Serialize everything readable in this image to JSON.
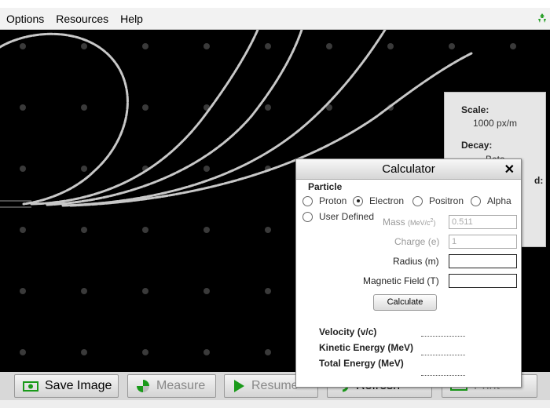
{
  "menu": [
    "Options",
    "Resources",
    "Help"
  ],
  "info_panel": {
    "scale_label": "Scale:",
    "scale_value": "1000 px/m",
    "decay_label": "Decay:",
    "decay_value": "Beta",
    "partial_label": "d:"
  },
  "toolbar": {
    "save_image": "Save Image",
    "measure": "Measure",
    "resume": "Resume",
    "refresh": "Refresh",
    "print": "Print"
  },
  "calculator": {
    "title": "Calculator",
    "close": "✕",
    "particle_heading": "Particle",
    "particles": [
      "Proton",
      "Electron",
      "Positron",
      "Alpha"
    ],
    "selected_particle": "Electron",
    "user_defined": "User Defined",
    "mass_label": "Mass",
    "mass_unit": "(MeV/c",
    "mass_unit_sup": "2",
    "mass_unit_end": ")",
    "mass_value": "0.511",
    "charge_label": "Charge (e)",
    "charge_value": "1",
    "radius_label": "Radius (m)",
    "radius_value": "",
    "field_label": "Magnetic Field (T)",
    "field_value": "",
    "calculate_button": "Calculate",
    "results": [
      "Velocity (v/c)",
      "Kinetic Energy (MeV)",
      "Total Energy (MeV)"
    ]
  },
  "colors": {
    "background": "#000000",
    "track": "#c8c8c8",
    "grid_dot": "#3a3a3a",
    "accent_green": "#1a9a1a"
  },
  "icons": [
    "recycle-icon",
    "camera-icon",
    "measure-icon",
    "play-icon",
    "refresh-icon",
    "print-icon"
  ]
}
